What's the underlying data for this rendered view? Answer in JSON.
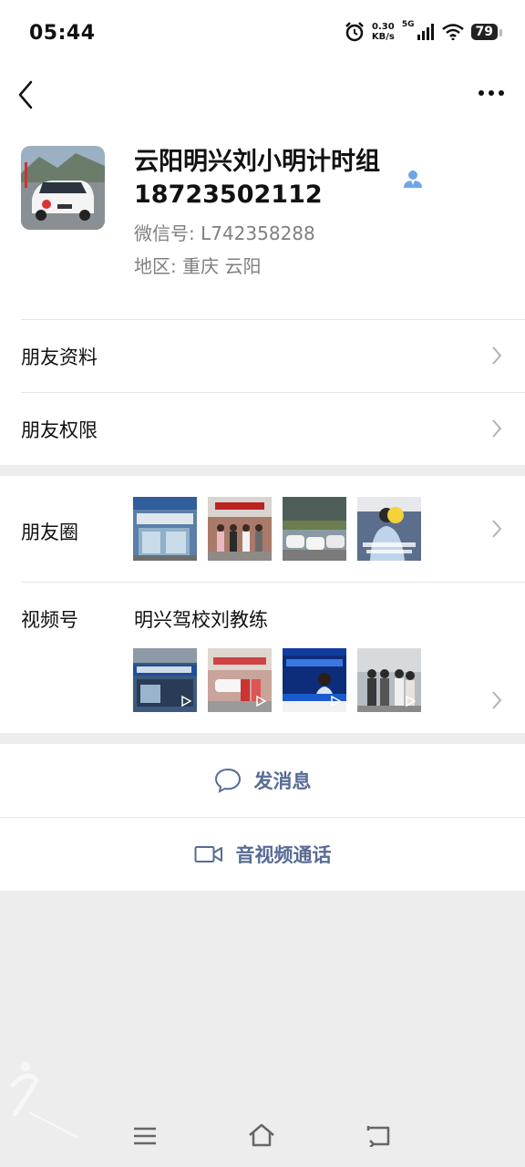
{
  "status": {
    "time": "05:44",
    "net_speed_value": "0.30",
    "net_speed_unit": "KB/s",
    "network": "5G",
    "battery": "79"
  },
  "profile": {
    "name": "云阳明兴刘小明计时组18723502112",
    "wechat_id": "微信号:  L742358288",
    "region": "地区:  重庆  云阳"
  },
  "menu": {
    "friend_info": "朋友资料",
    "friend_permissions": "朋友权限",
    "moments": "朋友圈",
    "channels": "视频号",
    "channel_name": "明兴驾校刘教练"
  },
  "actions": {
    "message": "发消息",
    "call": "音视频通话"
  },
  "icons": {
    "back": "chevron-left-icon",
    "more": "more-icon",
    "contact": "contact-icon",
    "chat": "chat-bubble-icon",
    "video": "video-camera-icon"
  },
  "colors": {
    "link": "#576b95",
    "contact_icon": "#6ea6e8",
    "background": "#ededed"
  }
}
